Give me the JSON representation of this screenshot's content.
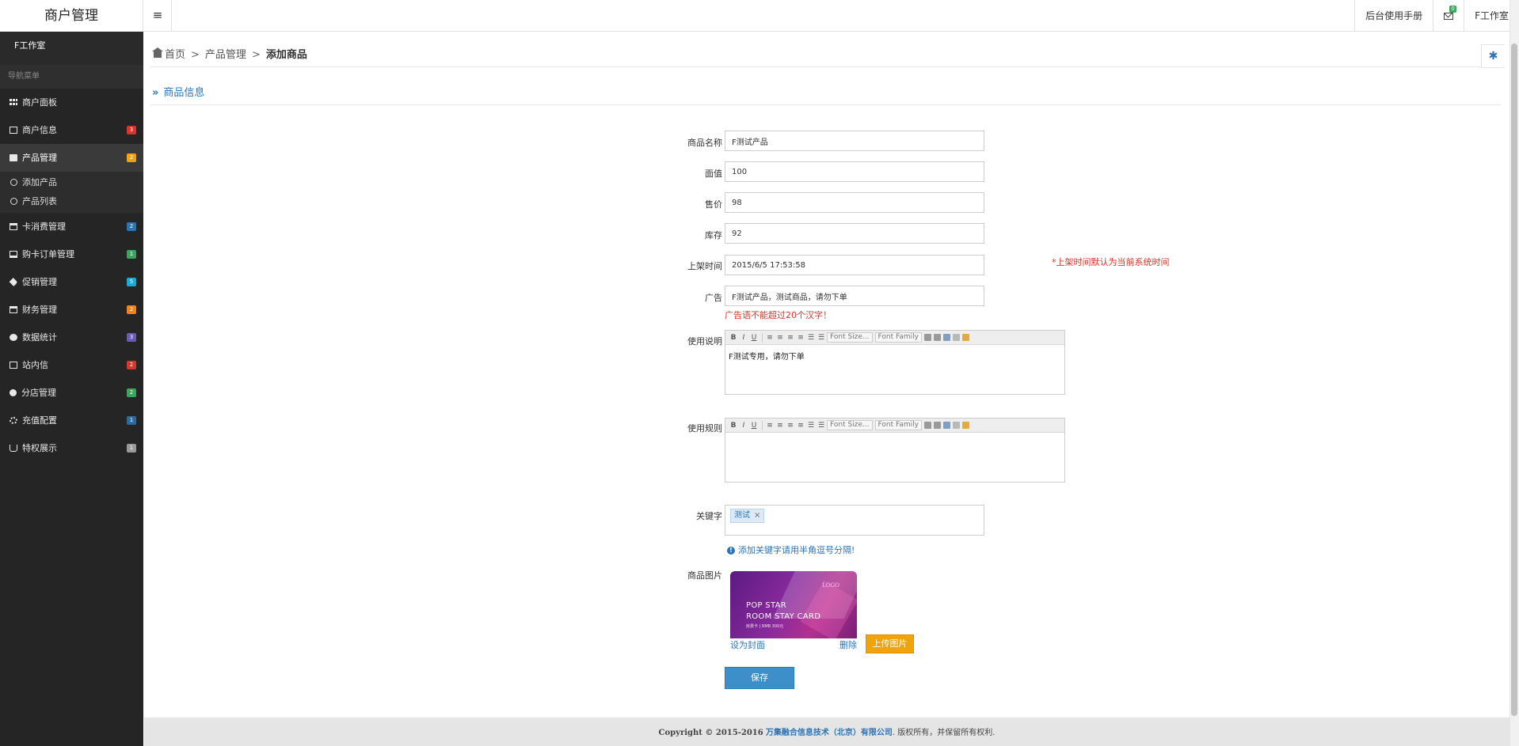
{
  "header": {
    "brand": "商户管理",
    "menu_toggle_glyph": "≡",
    "manual_link": "后台使用手册",
    "mail_badge": "0",
    "user_name": "F工作室"
  },
  "sidebar": {
    "user": "F工作室",
    "nav_heading": "导航菜单",
    "items": [
      {
        "label": "商户面板",
        "icon": "grid-icon",
        "badge": "",
        "badge_color": ""
      },
      {
        "label": "商户信息",
        "icon": "id-card-icon",
        "badge": "3",
        "badge_color": "#d9362b"
      },
      {
        "label": "产品管理",
        "icon": "briefcase-icon",
        "badge": "2",
        "badge_color": "#f0a30a"
      },
      {
        "label": "卡消费管理",
        "icon": "credit-card-icon",
        "badge": "2",
        "badge_color": "#2b74b8"
      },
      {
        "label": "购卡订单管理",
        "icon": "laptop-icon",
        "badge": "1",
        "badge_color": "#3aa55b"
      },
      {
        "label": "促销管理",
        "icon": "tags-icon",
        "badge": "5",
        "badge_color": "#1ba9d6"
      },
      {
        "label": "财务管理",
        "icon": "calendar-icon",
        "badge": "2",
        "badge_color": "#f0831e"
      },
      {
        "label": "数据统计",
        "icon": "pie-chart-icon",
        "badge": "3",
        "badge_color": "#6a5bb4"
      },
      {
        "label": "站内信",
        "icon": "envelope-icon",
        "badge": "2",
        "badge_color": "#d9362b"
      },
      {
        "label": "分店管理",
        "icon": "cogs-icon",
        "badge": "2",
        "badge_color": "#3aa55b"
      },
      {
        "label": "充值配置",
        "icon": "gear-icon",
        "badge": "1",
        "badge_color": "#2c6aa0"
      },
      {
        "label": "特权展示",
        "icon": "coffee-icon",
        "badge": "1",
        "badge_color": "#9a9a9a"
      }
    ],
    "sub_items": [
      {
        "label": "添加产品"
      },
      {
        "label": "产品列表"
      }
    ]
  },
  "breadcrumb": {
    "home": "首页",
    "sep": ">",
    "level2": "产品管理",
    "current": "添加商品"
  },
  "section": {
    "chevron": "»",
    "title": "商品信息"
  },
  "form": {
    "name_label": "商品名称",
    "name_value": "F测试产品",
    "face_label": "面值",
    "face_value": "100",
    "price_label": "售价",
    "price_value": "98",
    "stock_label": "库存",
    "stock_value": "92",
    "time_label": "上架时间",
    "time_value": "2015/6/5 17:53:58",
    "time_hint": "*上架时间默认为当前系统时间",
    "ad_label": "广告",
    "ad_value": "F测试产品，测试商品，请勿下单",
    "ad_hint": "广告语不能超过20个汉字！",
    "usage_label": "使用说明",
    "usage_text": "F测试专用，请勿下单",
    "rules_label": "使用规则",
    "rules_text": "",
    "keyword_label": "关键字",
    "keyword_tag": "测试",
    "keyword_tag_remove": "×",
    "keyword_hint_icon": "!",
    "keyword_hint": "添加关键字请用半角逗号分隔!",
    "image_label": "商品图片",
    "set_cover": "设为封面",
    "delete": "删除",
    "upload": "上传图片",
    "save": "保存"
  },
  "editor_toolbar": {
    "bold": "B",
    "italic": "I",
    "underline": "U",
    "font_size": "Font Size...",
    "font_family": "Font Family"
  },
  "card_image": {
    "logo": "LOGO",
    "line1": "POP STAR",
    "line2": "ROOM STAY CARD",
    "line3": "房费卡 | RMB 300元"
  },
  "footer": {
    "copyright": "Copyright © 2015-2016",
    "company": "万集融合信息技术（北京）有限公司",
    "rights": ". 版权所有，并保留所有权利."
  }
}
